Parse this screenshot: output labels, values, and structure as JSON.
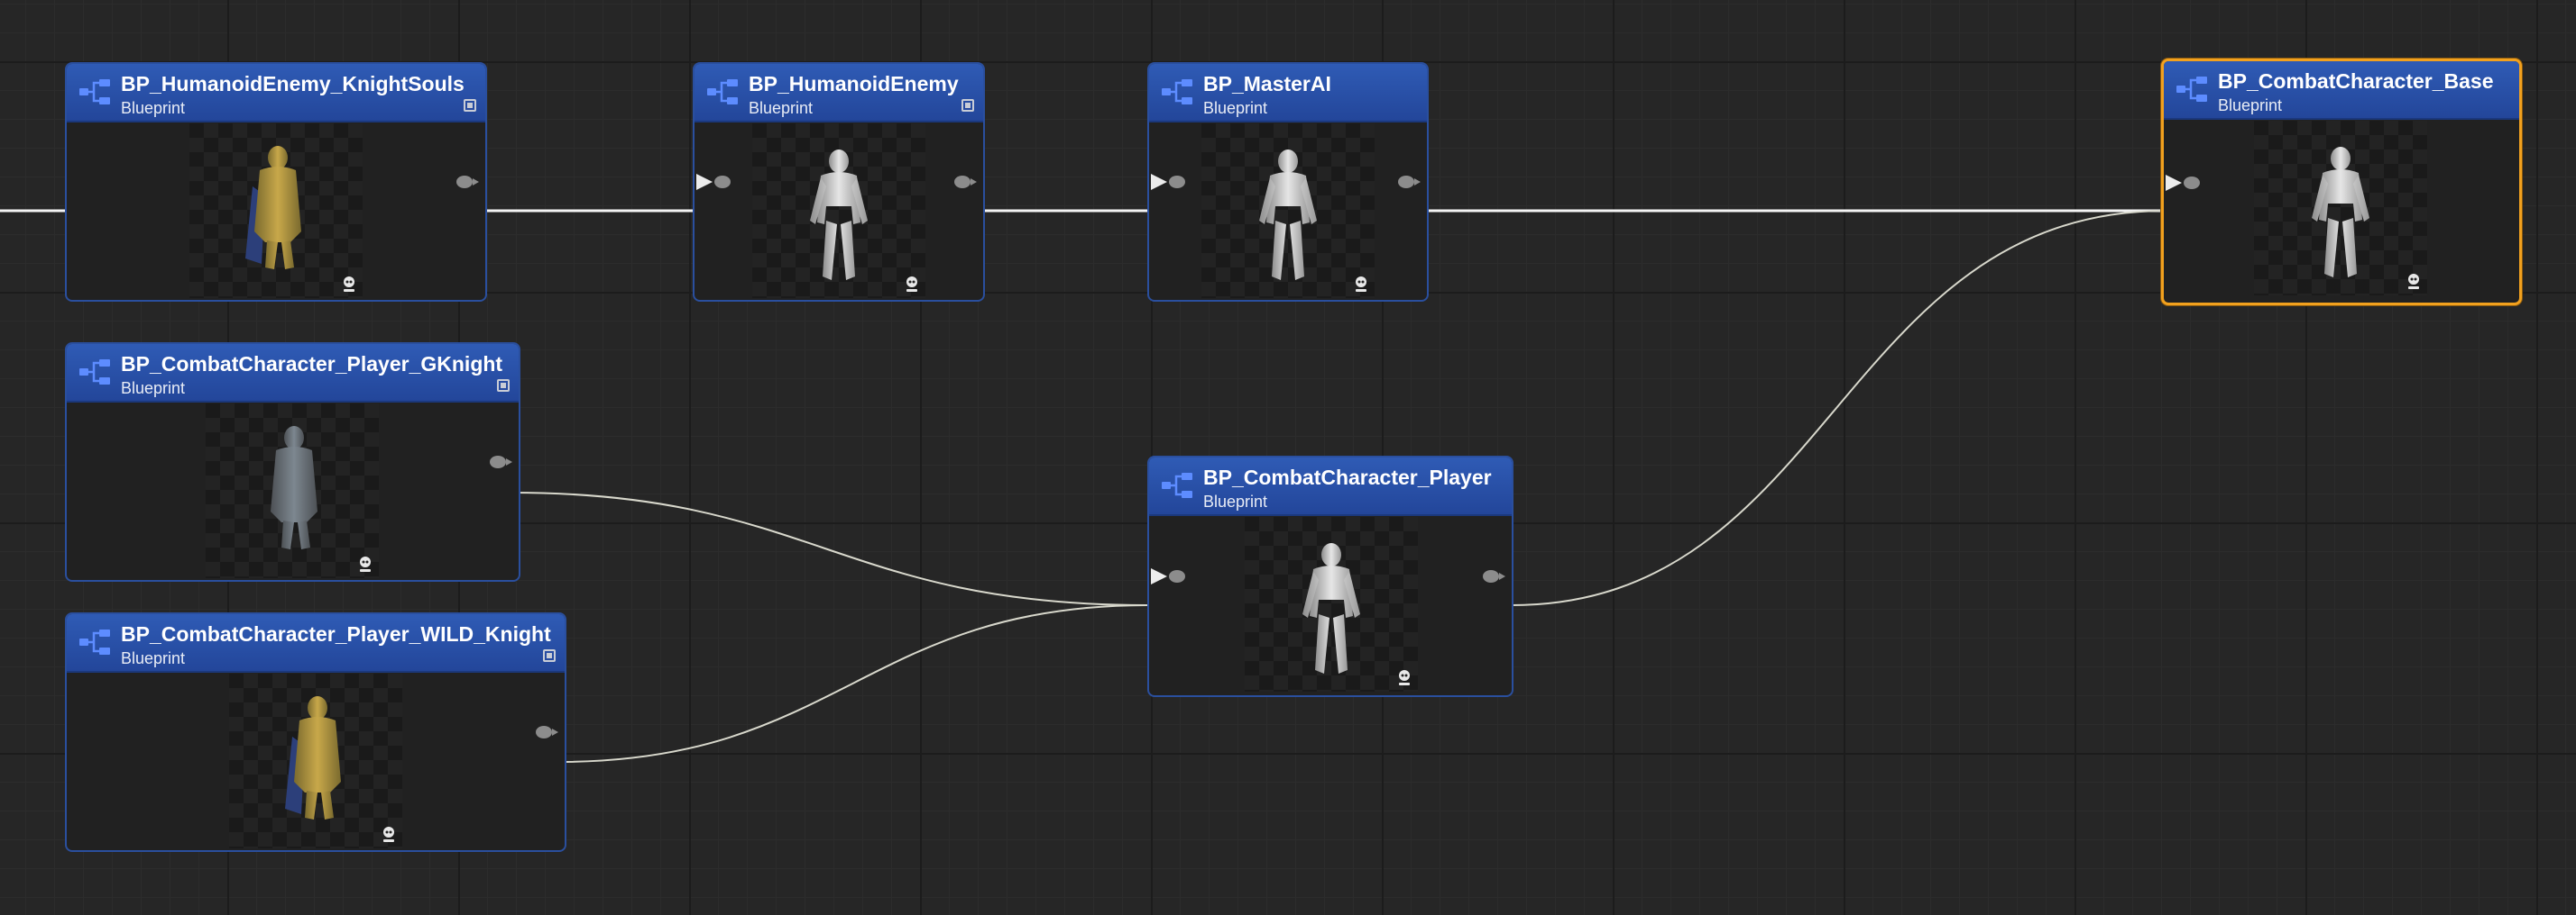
{
  "nodes": [
    {
      "id": "knightsouls",
      "title": "BP_HumanoidEnemy_KnightSouls",
      "subtitle": "Blueprint",
      "selected": false,
      "asset_icon": true,
      "figure": "knight-gold",
      "icon": "blueprint-class-icon"
    },
    {
      "id": "humanoid",
      "title": "BP_HumanoidEnemy",
      "subtitle": "Blueprint",
      "selected": false,
      "asset_icon": true,
      "figure": "mannequin",
      "icon": "blueprint-class-icon"
    },
    {
      "id": "masterai",
      "title": "BP_MasterAI",
      "subtitle": "Blueprint",
      "selected": false,
      "asset_icon": false,
      "figure": "mannequin",
      "icon": "blueprint-class-icon"
    },
    {
      "id": "base",
      "title": "BP_CombatCharacter_Base",
      "subtitle": "Blueprint",
      "selected": true,
      "asset_icon": false,
      "figure": "mannequin",
      "icon": "blueprint-class-icon"
    },
    {
      "id": "gknight",
      "title": "BP_CombatCharacter_Player_GKnight",
      "subtitle": "Blueprint",
      "selected": false,
      "asset_icon": true,
      "figure": "knight-dark",
      "icon": "blueprint-class-icon"
    },
    {
      "id": "wild",
      "title": "BP_CombatCharacter_Player_WILD_Knight",
      "subtitle": "Blueprint",
      "selected": false,
      "asset_icon": true,
      "figure": "knight-gold",
      "icon": "blueprint-class-icon"
    },
    {
      "id": "player",
      "title": "BP_CombatCharacter_Player",
      "subtitle": "Blueprint",
      "selected": false,
      "asset_icon": false,
      "figure": "mannequin",
      "icon": "blueprint-class-icon"
    }
  ],
  "links": [
    {
      "from": "offscreen-left",
      "to": "knightsouls"
    },
    {
      "from": "knightsouls",
      "to": "humanoid"
    },
    {
      "from": "humanoid",
      "to": "masterai"
    },
    {
      "from": "masterai",
      "to": "base"
    },
    {
      "from": "gknight",
      "to": "player"
    },
    {
      "from": "wild",
      "to": "player"
    },
    {
      "from": "player",
      "to": "base"
    }
  ],
  "colors": {
    "header": "#2f5bb5",
    "node_border": "#2a4f9e",
    "selected_border": "#f2a11e",
    "wire_bright": "#f4f4f4",
    "wire_curve": "#d8d8cc",
    "pin": "#8c8c8c"
  }
}
